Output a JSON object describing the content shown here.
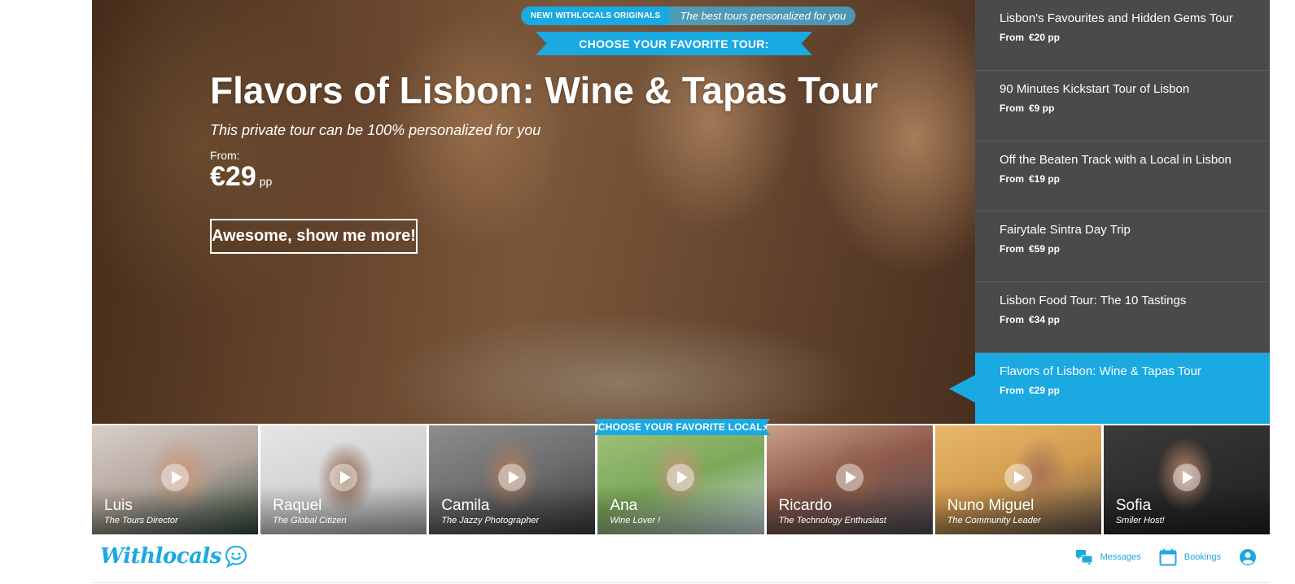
{
  "hero": {
    "badge": "NEW! WITHLOCALS ORIGINALS",
    "badge_sub": "The best tours personalized for you",
    "choose_tour_label": "CHOOSE YOUR FAVORITE TOUR:",
    "title": "Flavors of Lisbon: Wine & Tapas Tour",
    "subtitle": "This private tour can be 100% personalized for you",
    "from_label": "From:",
    "price": "€29",
    "price_unit": "pp",
    "cta_label": "Awesome, show me more!"
  },
  "tours": [
    {
      "name": "Lisbon's Favourites and Hidden Gems Tour",
      "from": "From",
      "price": "€20 pp"
    },
    {
      "name": "90 Minutes Kickstart Tour of Lisbon",
      "from": "From",
      "price": "€9 pp"
    },
    {
      "name": "Off the Beaten Track with a Local in Lisbon",
      "from": "From",
      "price": "€19 pp"
    },
    {
      "name": "Fairytale Sintra Day Trip",
      "from": "From",
      "price": "€59 pp"
    },
    {
      "name": "Lisbon Food Tour: The 10 Tastings",
      "from": "From",
      "price": "€34 pp"
    },
    {
      "name": "Flavors of Lisbon: Wine & Tapas Tour",
      "from": "From",
      "price": "€29 pp",
      "active": true
    }
  ],
  "locals_header": "CHOOSE YOUR FAVORITE LOCAL:",
  "locals": [
    {
      "name": "Luis",
      "role": "The Tours Director"
    },
    {
      "name": "Raquel",
      "role": "The Global Citizen"
    },
    {
      "name": "Camila",
      "role": "The Jazzy Photographer"
    },
    {
      "name": "Ana",
      "role": "Wine Lover !"
    },
    {
      "name": "Ricardo",
      "role": "The Technology Enthusiast"
    },
    {
      "name": "Nuno Miguel",
      "role": "The Community Leader"
    },
    {
      "name": "Sofia",
      "role": "Smiler Host!"
    }
  ],
  "nav": {
    "logo": "Withlocals",
    "messages": "Messages",
    "bookings": "Bookings",
    "icons": {
      "messages": "chat-bubbles-icon",
      "bookings": "calendar-icon",
      "account": "user-circle-icon"
    }
  },
  "colors": {
    "accent": "#1aa9e1",
    "list_bg": "#4a4a4a"
  }
}
